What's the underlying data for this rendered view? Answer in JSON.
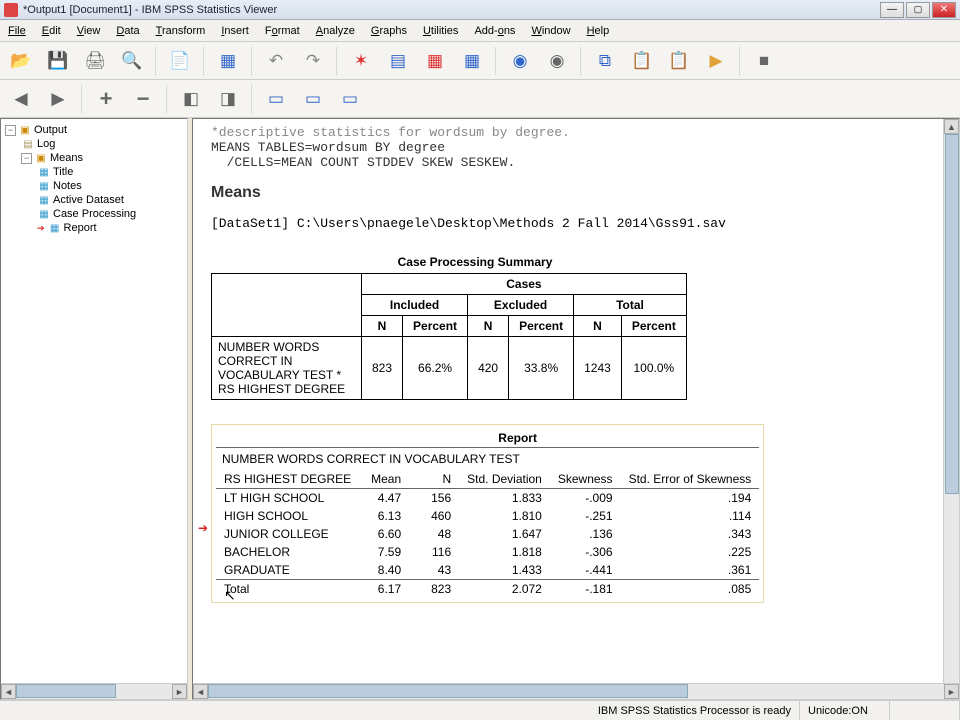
{
  "window": {
    "title": "*Output1 [Document1] - IBM SPSS Statistics Viewer"
  },
  "menu": {
    "file": "File",
    "edit": "Edit",
    "view": "View",
    "data": "Data",
    "transform": "Transform",
    "insert": "Insert",
    "format": "Format",
    "analyze": "Analyze",
    "graphs": "Graphs",
    "utilities": "Utilities",
    "addons": "Add-ons",
    "window": "Window",
    "help": "Help"
  },
  "tree": {
    "root": "Output",
    "log": "Log",
    "means": "Means",
    "title": "Title",
    "notes": "Notes",
    "active": "Active Dataset",
    "caseproc": "Case Processing",
    "report": "Report"
  },
  "content": {
    "syntax_line_top": "*descriptive statistics for wordsum by degree.",
    "syntax_line1": "MEANS TABLES=wordsum BY degree",
    "syntax_line2": "  /CELLS=MEAN COUNT STDDEV SKEW SESKEW.",
    "means_heading": "Means",
    "dataset_line": "[DataSet1] C:\\Users\\pnaegele\\Desktop\\Methods 2 Fall 2014\\Gss91.sav"
  },
  "case_summary": {
    "caption": "Case Processing Summary",
    "header_cases": "Cases",
    "col_included": "Included",
    "col_excluded": "Excluded",
    "col_total": "Total",
    "col_n": "N",
    "col_pct": "Percent",
    "row_label": "NUMBER WORDS CORRECT IN VOCABULARY TEST  * RS HIGHEST DEGREE",
    "inc_n": "823",
    "inc_pct": "66.2%",
    "exc_n": "420",
    "exc_pct": "33.8%",
    "tot_n": "1243",
    "tot_pct": "100.0%"
  },
  "report": {
    "caption": "Report",
    "subtitle": "NUMBER WORDS CORRECT IN VOCABULARY TEST",
    "col_group": "RS HIGHEST DEGREE",
    "col_mean": "Mean",
    "col_n": "N",
    "col_sd": "Std. Deviation",
    "col_skew": "Skewness",
    "col_sesk": "Std. Error of Skewness",
    "rows": [
      {
        "label": "LT HIGH SCHOOL",
        "mean": "4.47",
        "n": "156",
        "sd": "1.833",
        "skew": "-.009",
        "sesk": ".194"
      },
      {
        "label": "HIGH SCHOOL",
        "mean": "6.13",
        "n": "460",
        "sd": "1.810",
        "skew": "-.251",
        "sesk": ".114"
      },
      {
        "label": "JUNIOR COLLEGE",
        "mean": "6.60",
        "n": "48",
        "sd": "1.647",
        "skew": ".136",
        "sesk": ".343"
      },
      {
        "label": "BACHELOR",
        "mean": "7.59",
        "n": "116",
        "sd": "1.818",
        "skew": "-.306",
        "sesk": ".225"
      },
      {
        "label": "GRADUATE",
        "mean": "8.40",
        "n": "43",
        "sd": "1.433",
        "skew": "-.441",
        "sesk": ".361"
      }
    ],
    "total": {
      "label": "Total",
      "mean": "6.17",
      "n": "823",
      "sd": "2.072",
      "skew": "-.181",
      "sesk": ".085"
    }
  },
  "status": {
    "processor": "IBM SPSS Statistics Processor is ready",
    "unicode": "Unicode:ON"
  }
}
